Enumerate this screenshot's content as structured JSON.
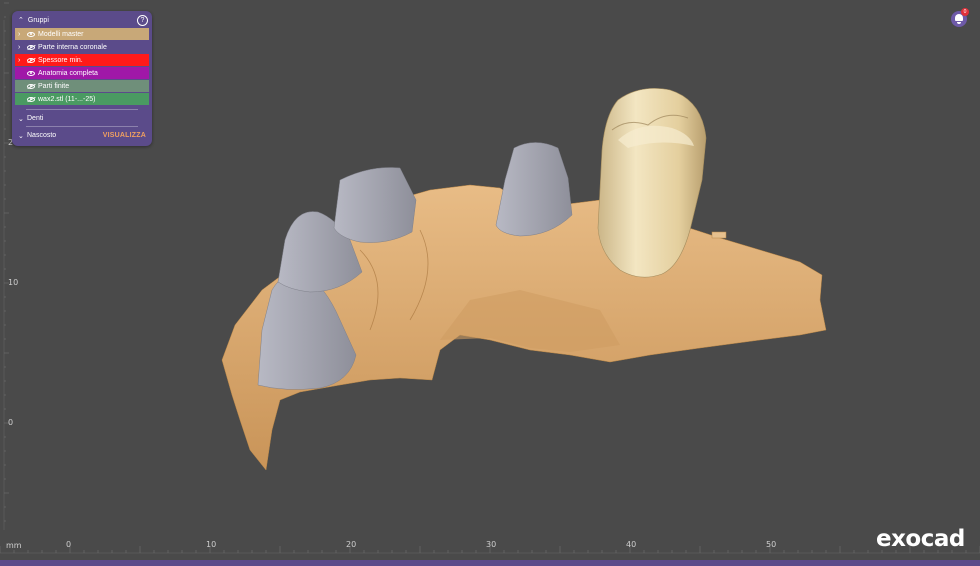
{
  "panel": {
    "title": "Gruppi",
    "help_icon": "question-circle-icon",
    "items": [
      {
        "label": "Modelli master",
        "color": "#c8a878",
        "expand": true,
        "hidden": false
      },
      {
        "label": "Parte interna coronale",
        "color": "#5b4b8a",
        "expand": true,
        "hidden": true
      },
      {
        "label": "Spessore min.",
        "color": "#ff1a1a",
        "expand": true,
        "hidden": true
      },
      {
        "label": "Anatomia completa",
        "color": "#a018a8",
        "expand": false,
        "hidden": false
      },
      {
        "label": "Parti finite",
        "color": "#6f8f7a",
        "expand": false,
        "hidden": true
      },
      {
        "label": "wax2.stl (11-...-25)",
        "color": "#4a9a62",
        "expand": false,
        "hidden": true
      }
    ],
    "denti_label": "Denti",
    "nascosto_label": "Nascosto",
    "visualizza_label": "VISUALIZZA"
  },
  "notification": {
    "count": "0"
  },
  "logo": {
    "text": "exocad"
  },
  "ruler": {
    "unit": "mm",
    "x_ticks": [
      "0",
      "10",
      "20",
      "30",
      "40",
      "50"
    ],
    "y_ticks": [
      "20",
      "10",
      "0"
    ]
  },
  "colors": {
    "background": "#4a4a4a",
    "gingiva": "#e2b07a",
    "prep": "#a8a9b3",
    "crown": "#e8d6a8",
    "accent": "#5b4b8a"
  }
}
